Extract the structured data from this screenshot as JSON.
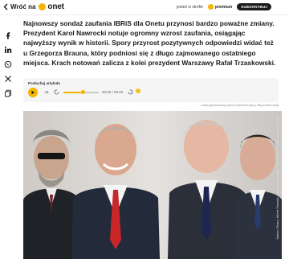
{
  "header": {
    "back_label": "Wróć na",
    "brand_name": "onet",
    "trust_prefix": "jesteś w strefie",
    "premium_label": "premium",
    "subscribe_label": "SUBSKRYBUJ"
  },
  "social": {
    "icons": [
      "facebook-icon",
      "linkedin-icon",
      "whatsapp-icon",
      "x-icon",
      "copy-icon"
    ]
  },
  "article": {
    "lead": "Najnowszy sondaż zaufania IBRiS dla Onetu przynosi bardzo poważne zmiany. Prezydent Karol Nawrocki notuje ogromny wzrost zaufania, osiągając najwyższy wynik w historii. Spory przyrost pozytywnych odpowiedzi widać też u Grzegorza Brauna, który podniosi się z długo zajmowanego ostatniego miejsca. Krach notowań zalicza z kolei prezydent Warszawy Rafał Trzaskowski."
  },
  "player": {
    "label": "Posłuchaj artykułu",
    "rate": "x1",
    "time": "00:00 / 00:00",
    "progress": 0.55
  },
  "credits": {
    "top": "Lektor generowany przez AI (ElevenLabs) | Więcej informacji",
    "photo": "Marcin Obara, Albert Zawada, Leszek Szymański, Piotr Nowak, Paweł Supernak / PAP"
  },
  "colors": {
    "accent": "#f5b400",
    "dark": "#1a1a1a"
  }
}
